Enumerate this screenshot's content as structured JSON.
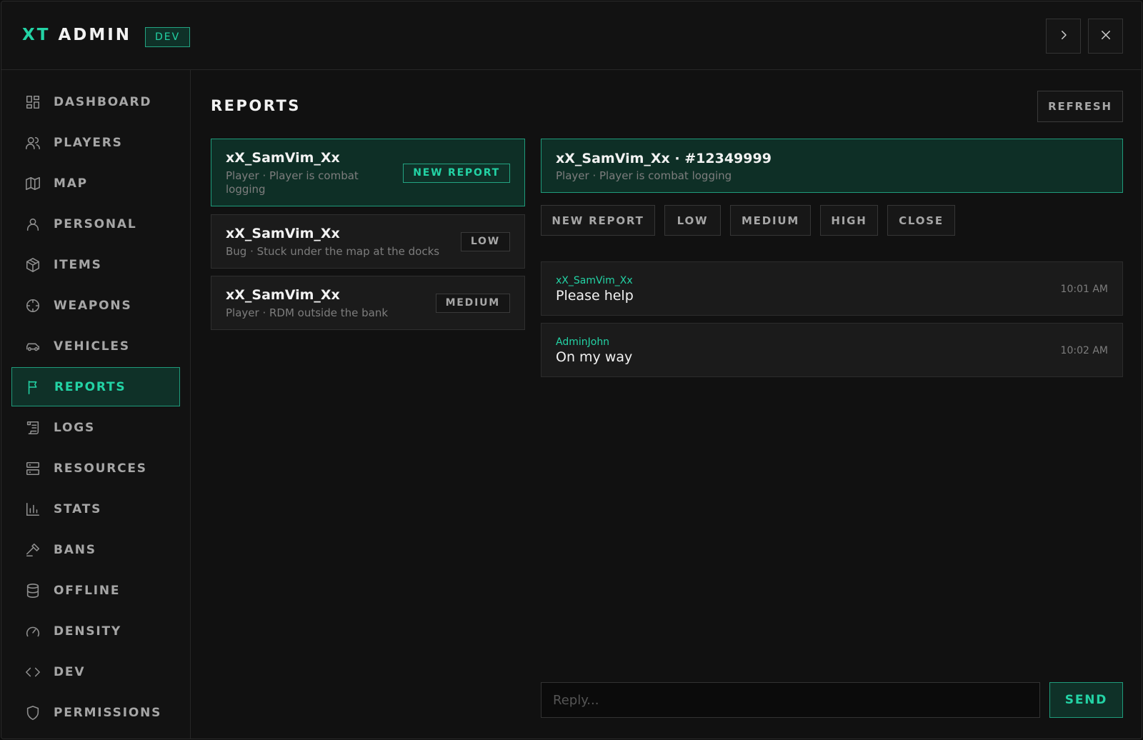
{
  "app": {
    "brand_primary": "XT",
    "brand_secondary": "ADMIN",
    "env_badge": "DEV",
    "accent_color": "#23d3a5"
  },
  "header": {
    "next_icon": "chevron-right-icon",
    "close_icon": "close-icon"
  },
  "sidebar": {
    "items": [
      {
        "label": "DASHBOARD",
        "icon": "dashboard-grid-icon",
        "active": false
      },
      {
        "label": "PLAYERS",
        "icon": "users-icon",
        "active": false
      },
      {
        "label": "MAP",
        "icon": "map-icon",
        "active": false
      },
      {
        "label": "PERSONAL",
        "icon": "user-icon",
        "active": false
      },
      {
        "label": "ITEMS",
        "icon": "box-icon",
        "active": false
      },
      {
        "label": "WEAPONS",
        "icon": "crosshair-icon",
        "active": false
      },
      {
        "label": "VEHICLES",
        "icon": "car-icon",
        "active": false
      },
      {
        "label": "REPORTS",
        "icon": "flag-icon",
        "active": true
      },
      {
        "label": "LOGS",
        "icon": "scroll-icon",
        "active": false
      },
      {
        "label": "RESOURCES",
        "icon": "server-icon",
        "active": false
      },
      {
        "label": "STATS",
        "icon": "bar-chart-icon",
        "active": false
      },
      {
        "label": "BANS",
        "icon": "gavel-icon",
        "active": false
      },
      {
        "label": "OFFLINE",
        "icon": "database-icon",
        "active": false
      },
      {
        "label": "DENSITY",
        "icon": "gauge-icon",
        "active": false
      },
      {
        "label": "DEV",
        "icon": "code-icon",
        "active": false
      },
      {
        "label": "PERMISSIONS",
        "icon": "shield-icon",
        "active": false
      }
    ]
  },
  "main": {
    "title": "REPORTS",
    "refresh_label": "REFRESH",
    "reports": [
      {
        "name": "xX_SamVim_Xx",
        "subtitle": "Player · Player is combat logging",
        "tag": "NEW REPORT",
        "selected": true
      },
      {
        "name": "xX_SamVim_Xx",
        "subtitle": "Bug · Stuck under the map at the docks",
        "tag": "LOW",
        "selected": false
      },
      {
        "name": "xX_SamVim_Xx",
        "subtitle": "Player · RDM outside the bank",
        "tag": "MEDIUM",
        "selected": false
      }
    ],
    "detail": {
      "title": "xX_SamVim_Xx · #12349999",
      "subtitle": "Player · Player is combat logging",
      "status_buttons": [
        "NEW REPORT",
        "LOW",
        "MEDIUM",
        "HIGH",
        "CLOSE"
      ],
      "messages": [
        {
          "author": "xX_SamVim_Xx",
          "text": "Please help",
          "time": "10:01 AM"
        },
        {
          "author": "AdminJohn",
          "text": "On my way",
          "time": "10:02 AM"
        }
      ],
      "reply_placeholder": "Reply...",
      "send_label": "SEND"
    }
  }
}
